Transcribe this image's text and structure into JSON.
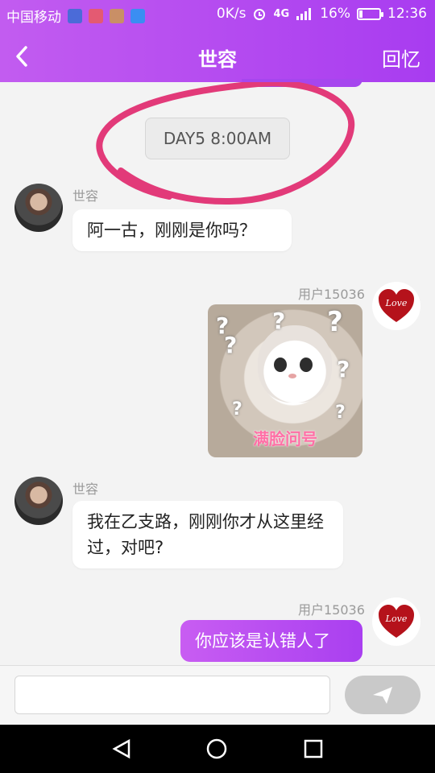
{
  "status_bar": {
    "carrier": "中国移动",
    "speed": "0K/s",
    "network": "4G",
    "network_small": "4G",
    "battery": "16%",
    "battery_level": 0.16,
    "time": "12:36"
  },
  "header": {
    "back_icon": "chevron-left-icon",
    "title": "世容",
    "right_action": "回忆"
  },
  "chat": {
    "time_chip": "DAY5  8:00AM",
    "messages": [
      {
        "sender": "世容",
        "side": "left",
        "text": "阿一古，刚刚是你吗？"
      },
      {
        "sender": "用户15036",
        "side": "right",
        "type": "image",
        "image_caption": "满脸问号"
      },
      {
        "sender": "世容",
        "side": "left",
        "text": "我在乙支路，刚刚你才从这里经过，对吧?"
      },
      {
        "sender": "用户15036",
        "side": "right",
        "text": "你应该是认错人了"
      }
    ],
    "love_avatar_label": "Love"
  },
  "input": {
    "placeholder": "",
    "send_icon": "send-paper-plane-icon"
  },
  "colors": {
    "accent": "#b04af0",
    "annotation": "#e23a79"
  }
}
